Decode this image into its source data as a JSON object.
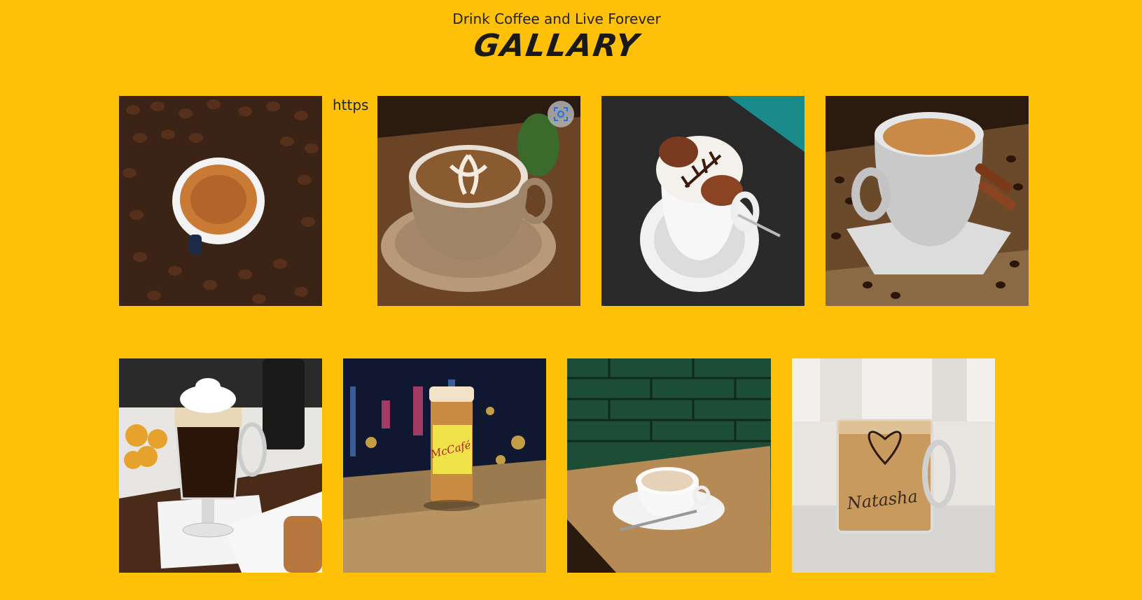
{
  "header": {
    "subtitle": "Drink Coffee and Live Forever",
    "title": "GALLARY"
  },
  "broken_image_alt": "https",
  "gallery": [
    {
      "name": "espresso-on-beans",
      "bg": "#3b2316",
      "accent": "#c97a35"
    },
    {
      "name": "latte-art-cup",
      "bg": "#5a3a22",
      "accent": "#e8d7c2"
    },
    {
      "name": "cappuccino-chocolate",
      "bg": "#2a2a2a",
      "accent": "#f4f1ec"
    },
    {
      "name": "white-cup-cinnamon",
      "bg": "#6b4a2c",
      "accent": "#d8d8d8"
    },
    {
      "name": "irish-coffee-glass",
      "bg": "#e8e6e3",
      "accent": "#2b1408"
    },
    {
      "name": "mccafe-cup-street",
      "bg": "#1b2a4a",
      "accent": "#f0e24a"
    },
    {
      "name": "flat-white-table",
      "bg": "#1d4d34",
      "accent": "#b68a55"
    },
    {
      "name": "natasha-glass-mug",
      "bg": "#e9e6e1",
      "accent": "#c99a5e"
    }
  ],
  "mug_text": "Natasha",
  "mccafe_text": "McCafé"
}
